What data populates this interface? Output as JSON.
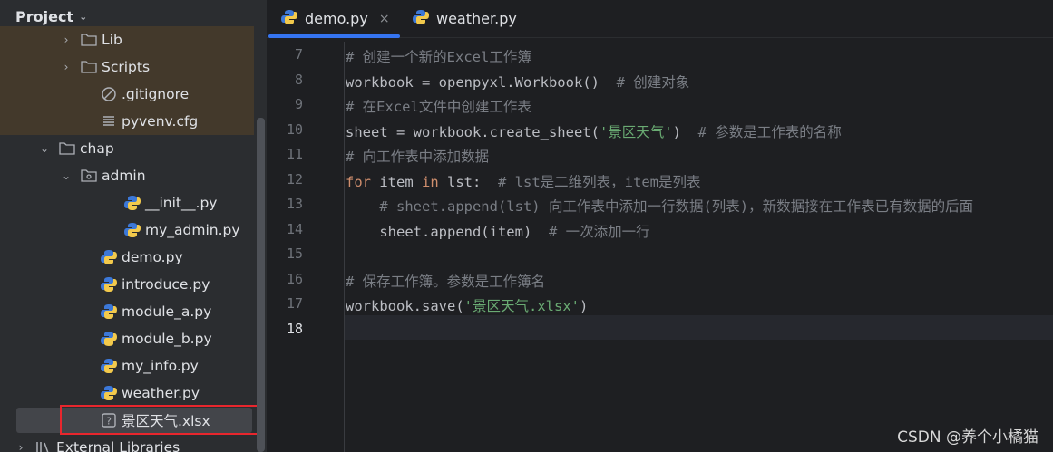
{
  "project_panel": {
    "title": "Project",
    "tree": [
      {
        "label": "Lib",
        "type": "folder",
        "arrow": "›"
      },
      {
        "label": "Scripts",
        "type": "folder",
        "arrow": "›"
      },
      {
        "label": ".gitignore",
        "type": "ignore"
      },
      {
        "label": "pyvenv.cfg",
        "type": "cfg"
      },
      {
        "label": "chap",
        "type": "folder",
        "arrow": "⌄"
      },
      {
        "label": "admin",
        "type": "package",
        "arrow": "⌄"
      },
      {
        "label": "__init__.py",
        "type": "py"
      },
      {
        "label": "my_admin.py",
        "type": "py"
      },
      {
        "label": "demo.py",
        "type": "py"
      },
      {
        "label": "introduce.py",
        "type": "py"
      },
      {
        "label": "module_a.py",
        "type": "py"
      },
      {
        "label": "module_b.py",
        "type": "py"
      },
      {
        "label": "my_info.py",
        "type": "py"
      },
      {
        "label": "weather.py",
        "type": "py"
      },
      {
        "label": "景区天气.xlsx",
        "type": "unknown"
      },
      {
        "label": "External Libraries",
        "type": "libs",
        "arrow": "›"
      }
    ]
  },
  "tabs": [
    {
      "label": "demo.py",
      "active": true
    },
    {
      "label": "weather.py",
      "active": false
    }
  ],
  "editor": {
    "line_numbers": [
      "7",
      "8",
      "9",
      "10",
      "11",
      "12",
      "13",
      "14",
      "15",
      "16",
      "17",
      "18"
    ],
    "current_line": "18",
    "lines": [
      [
        {
          "t": "cm",
          "v": "# 创建一个新的Excel工作簿"
        }
      ],
      [
        {
          "t": "plain",
          "v": "workbook = openpyxl.Workbook()  "
        },
        {
          "t": "cm",
          "v": "# 创建对象"
        }
      ],
      [
        {
          "t": "cm",
          "v": "# 在Excel文件中创建工作表"
        }
      ],
      [
        {
          "t": "plain",
          "v": "sheet = workbook.create_sheet("
        },
        {
          "t": "str",
          "v": "'景区天气'"
        },
        {
          "t": "plain",
          "v": ")  "
        },
        {
          "t": "cm",
          "v": "# 参数是工作表的名称"
        }
      ],
      [
        {
          "t": "cm",
          "v": "# 向工作表中添加数据"
        }
      ],
      [
        {
          "t": "kw",
          "v": "for "
        },
        {
          "t": "plain",
          "v": "item "
        },
        {
          "t": "kw",
          "v": "in "
        },
        {
          "t": "plain",
          "v": "lst:  "
        },
        {
          "t": "cm",
          "v": "# lst是二维列表，item是列表"
        }
      ],
      [
        {
          "t": "cm",
          "v": "    # sheet.append(lst) 向工作表中添加一行数据(列表)，新数据接在工作表已有数据的后面"
        }
      ],
      [
        {
          "t": "plain",
          "v": "    sheet.append(item)  "
        },
        {
          "t": "cm",
          "v": "# 一次添加一行"
        }
      ],
      [],
      [
        {
          "t": "cm",
          "v": "# 保存工作簿。参数是工作簿名"
        }
      ],
      [
        {
          "t": "plain",
          "v": "workbook.save("
        },
        {
          "t": "str",
          "v": "'景区天气.xlsx'"
        },
        {
          "t": "plain",
          "v": ")"
        }
      ],
      []
    ]
  },
  "watermark": "CSDN @养个小橘猫",
  "colors": {
    "accent": "#3574f0",
    "selection_box": "#e8262d",
    "comment": "#7a7e85",
    "keyword": "#cf8e6d",
    "string": "#6aab73"
  }
}
